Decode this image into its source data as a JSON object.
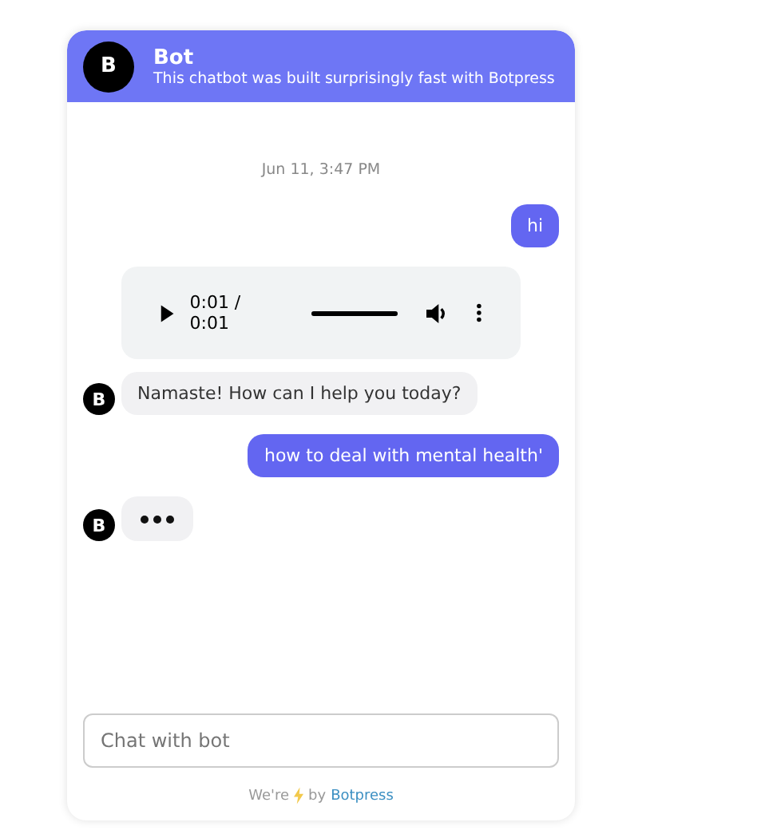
{
  "header": {
    "avatar": "B",
    "title": "Bot",
    "subtitle": "This chatbot was built surprisingly fast with Botpress"
  },
  "timestamp": "Jun 11, 3:47 PM",
  "messages": [
    {
      "kind": "user",
      "text": "hi"
    },
    {
      "kind": "audio",
      "time": "0:01 / 0:01",
      "level": 1
    },
    {
      "kind": "bot",
      "avatar": "B",
      "text": "Namaste! How can I help you today?"
    },
    {
      "kind": "user",
      "text": "how to deal with mental health'"
    },
    {
      "kind": "typing",
      "avatar": "B"
    }
  ],
  "composer": {
    "placeholder": "Chat with bot"
  },
  "footer": {
    "before": "We're",
    "after": "by",
    "link": "Botpress"
  }
}
